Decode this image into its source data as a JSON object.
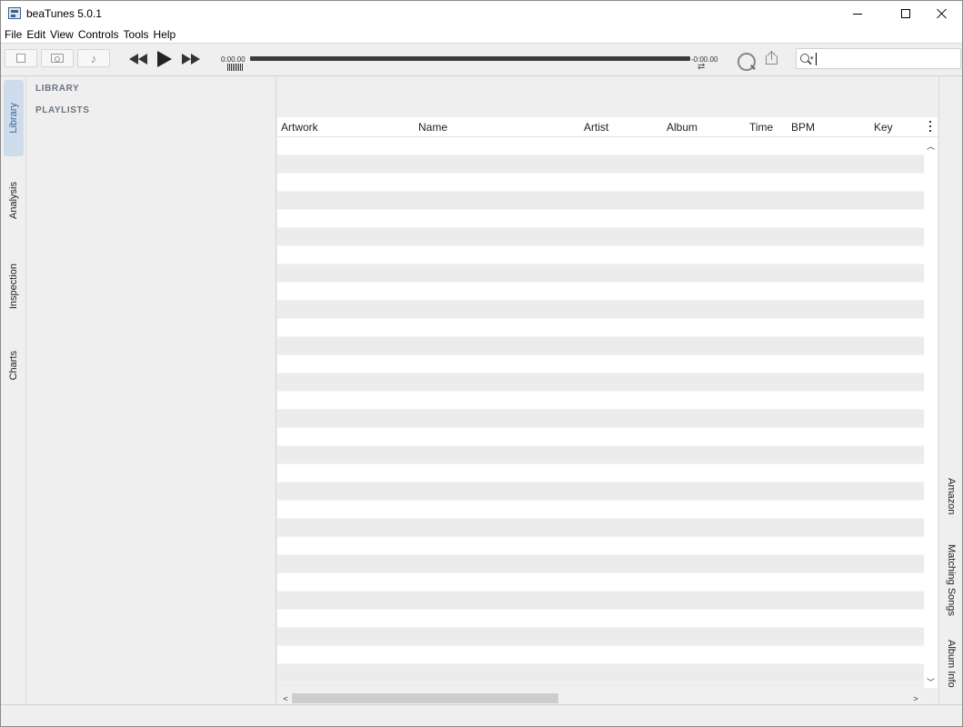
{
  "window": {
    "title": "beaTunes 5.0.1"
  },
  "menu": {
    "items": [
      "File",
      "Edit",
      "View",
      "Controls",
      "Tools",
      "Help"
    ]
  },
  "toolbar": {
    "time_elapsed": "0:00.00",
    "time_remaining": "-0:00.00",
    "progress": 0,
    "search": {
      "value": "",
      "placeholder": ""
    },
    "icons": {
      "button1": "document-icon",
      "button2": "folder-search-icon",
      "button3": "music-note-icon",
      "rewind": "rewind-icon",
      "play": "play-icon",
      "fast_forward": "fast-forward-icon",
      "repeat": "repeat-icon",
      "dial": "analysis-dial-icon",
      "share": "share-icon",
      "search": "search-icon"
    }
  },
  "left_tabs": {
    "items": [
      {
        "label": "Library",
        "active": true
      },
      {
        "label": "Analysis",
        "active": false
      },
      {
        "label": "Inspection",
        "active": false
      },
      {
        "label": "Charts",
        "active": false
      }
    ]
  },
  "sidebar": {
    "library_heading": "LIBRARY",
    "playlists_heading": "PLAYLISTS"
  },
  "table": {
    "columns": [
      "Artwork",
      "Name",
      "Artist",
      "Album",
      "Time",
      "BPM",
      "Key"
    ],
    "rows": []
  },
  "right_tabs": {
    "items": [
      {
        "label": "Amazon"
      },
      {
        "label": "Matching Songs"
      },
      {
        "label": "Album Info"
      }
    ]
  },
  "colors": {
    "accent": "#3b6aa0",
    "active_tab_bg": "#cfdcec",
    "row_alt": "#ececec"
  }
}
